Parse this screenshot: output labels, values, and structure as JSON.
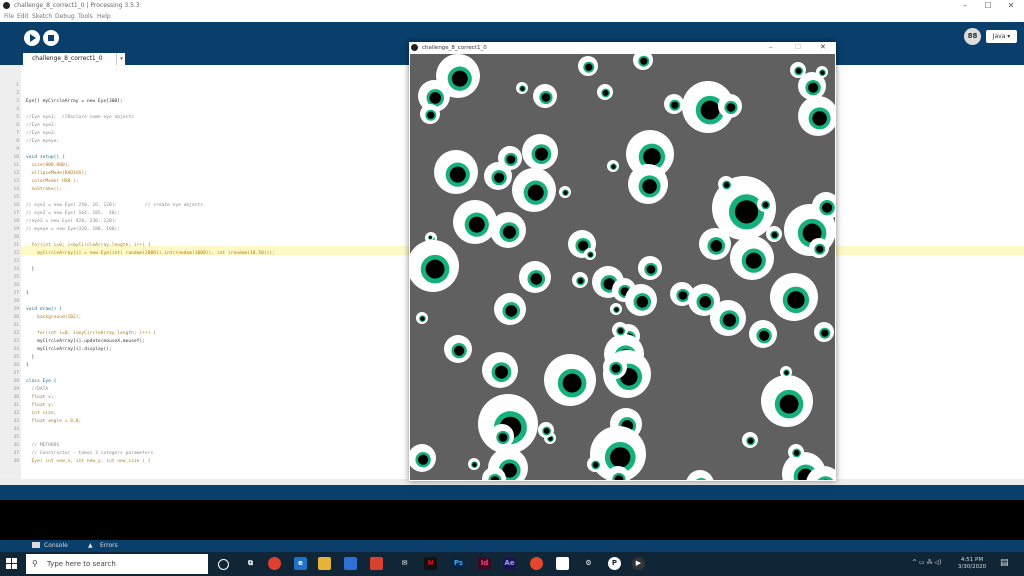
{
  "window": {
    "title": "challenge_8_correct1_0 | Processing 3.5.3",
    "controls": [
      "–",
      "☐",
      "✕"
    ]
  },
  "menu": [
    "File",
    "Edit",
    "Sketch",
    "Debug",
    "Tools",
    "Help"
  ],
  "toolbar": {
    "run_icon": "play-icon",
    "stop_icon": "stop-icon",
    "mode_label": "Java ▾",
    "mode_icon_text": "88"
  },
  "tab": {
    "label": "challenge_8_correct1_0",
    "arrow": "▾"
  },
  "code": [
    {
      "n": "1",
      "t": ""
    },
    {
      "n": "2",
      "t": ""
    },
    {
      "n": "3",
      "t": "Eye[] myCircleArray = new Eye[300];",
      "c": ""
    },
    {
      "n": "4",
      "t": ""
    },
    {
      "n": "5",
      "t": "//Eye eye1;  //Declare some eye objects",
      "c": "cm"
    },
    {
      "n": "6",
      "t": "//Eye eye2;",
      "c": "cm"
    },
    {
      "n": "7",
      "t": "//Eye eye3;",
      "c": "cm"
    },
    {
      "n": "8",
      "t": "//Eye myeye;",
      "c": "cm"
    },
    {
      "n": "9",
      "t": ""
    },
    {
      "n": "10",
      "t": "void setup() {",
      "c": "kw"
    },
    {
      "n": "11",
      "t": "  size(800,800);",
      "c": "fn"
    },
    {
      "n": "12",
      "t": "  ellipseMode(RADIUS);",
      "c": "fn"
    },
    {
      "n": "13",
      "t": "  colorMode( HSB );",
      "c": "fn"
    },
    {
      "n": "14",
      "t": "  noStroke();",
      "c": "fn"
    },
    {
      "n": "15",
      "t": ""
    },
    {
      "n": "16",
      "t": "// eye1 = new Eye( 250, 16, 120);          // create eye objects",
      "c": "cm"
    },
    {
      "n": "17",
      "t": "// eye2 = new Eye( 164, 185,  40);",
      "c": "cm"
    },
    {
      "n": "18",
      "t": "//eye3 = new Eye( 420, 230, 220);",
      "c": "cm"
    },
    {
      "n": "19",
      "t": "// myeye = new Eye(320, 180, 100);",
      "c": "cm"
    },
    {
      "n": "20",
      "t": ""
    },
    {
      "n": "21",
      "t": "  for(int i=0; i<myCircleArray.length; i++) {",
      "c": "fn"
    },
    {
      "n": "22",
      "t": "    myCircleArray[i] = new Eye(int( random(2000)),int(random(1000)), int (random(10,50)));",
      "c": "fn"
    },
    {
      "n": "23",
      "t": ""
    },
    {
      "n": "24",
      "t": "  }",
      "c": ""
    },
    {
      "n": "25",
      "t": ""
    },
    {
      "n": "26",
      "t": ""
    },
    {
      "n": "27",
      "t": "}",
      "c": ""
    },
    {
      "n": "28",
      "t": ""
    },
    {
      "n": "29",
      "t": "void draw() {",
      "c": "kw"
    },
    {
      "n": "30",
      "t": "    background(102);",
      "c": "fn"
    },
    {
      "n": "31",
      "t": ""
    },
    {
      "n": "32",
      "t": "    for(int i=0; i<myCircleArray.length; i++) {",
      "c": "fn"
    },
    {
      "n": "33",
      "t": "    myCircleArray[i].update(mouseX,mouseY);",
      "c": ""
    },
    {
      "n": "34",
      "t": "    myCircleArray[i].display();",
      "c": ""
    },
    {
      "n": "35",
      "t": "  }",
      "c": ""
    },
    {
      "n": "36",
      "t": "}",
      "c": ""
    },
    {
      "n": "37",
      "t": ""
    },
    {
      "n": "38",
      "t": "class Eye {",
      "c": "kw"
    },
    {
      "n": "39",
      "t": "  //DATA",
      "c": "cm"
    },
    {
      "n": "40",
      "t": "  float x;",
      "c": "fn"
    },
    {
      "n": "41",
      "t": "  float y;",
      "c": "fn"
    },
    {
      "n": "42",
      "t": "  int size;",
      "c": "fn"
    },
    {
      "n": "43",
      "t": "  float angle = 0.0;",
      "c": "fn"
    },
    {
      "n": "44",
      "t": ""
    },
    {
      "n": "45",
      "t": ""
    },
    {
      "n": "46",
      "t": "  // METHODS",
      "c": "cm"
    },
    {
      "n": "47",
      "t": "  // Constructor - takes 3 integers parameters",
      "c": "cm"
    },
    {
      "n": "48",
      "t": "  Eye( int new_x, int new_y, int new_size ) {",
      "c": "fn"
    }
  ],
  "sketch": {
    "title": "challenge_8_correct1_0",
    "controls": [
      "–",
      "☐",
      "✕"
    ],
    "background": "#606060"
  },
  "console_tabs": {
    "console": "Console",
    "errors": "Errors"
  },
  "taskbar": {
    "search_placeholder": "Type here to search",
    "time": "4:51 PM",
    "date": "3/30/2020"
  },
  "colors": {
    "accent": "#0a3e6b",
    "iris": "#16b07a"
  }
}
